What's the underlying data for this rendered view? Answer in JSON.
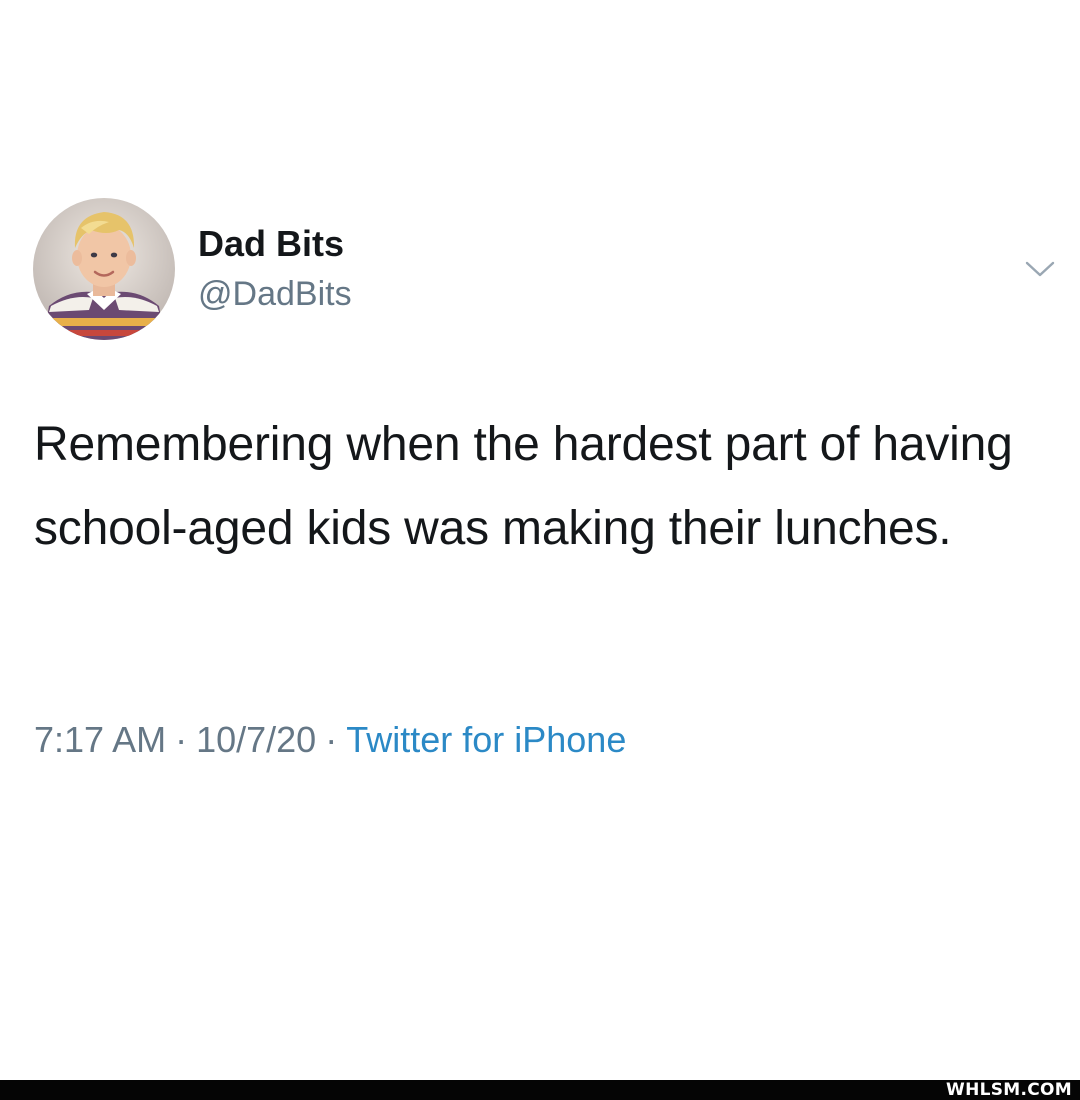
{
  "tweet": {
    "author": {
      "display_name": "Dad Bits",
      "handle": "@DadBits"
    },
    "avatar_icon": "profile-photo",
    "menu_icon": "chevron-down-icon",
    "text": "Remembering when the hardest part of having school-aged kids was making their lunches.",
    "meta": {
      "time": "7:17 AM",
      "separator": "·",
      "date": "10/7/20",
      "source": "Twitter for iPhone"
    }
  },
  "footer": {
    "watermark": "WHLSM.COM"
  },
  "colors": {
    "text_primary": "#14171a",
    "text_secondary": "#657786",
    "link": "#2b89c6",
    "footer_bg": "#050505"
  }
}
